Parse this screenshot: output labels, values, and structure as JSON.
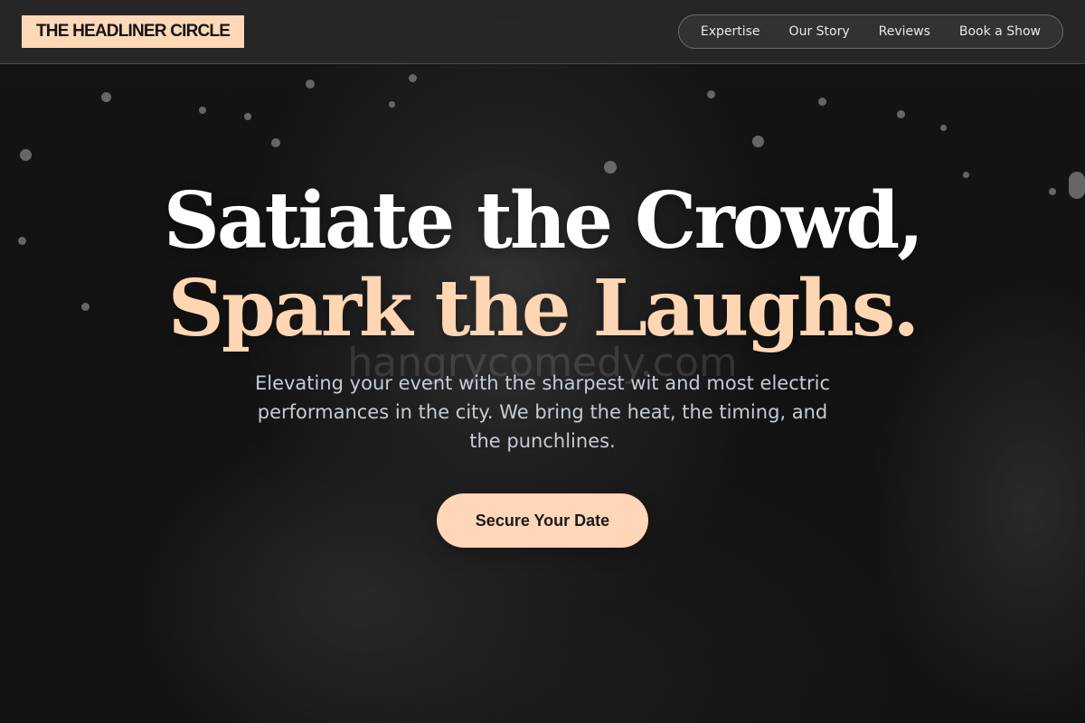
{
  "header": {
    "logo": "THE HEADLINER CIRCLE",
    "nav": [
      "Expertise",
      "Our Story",
      "Reviews",
      "Book a Show"
    ]
  },
  "hero": {
    "headline_line1": "Satiate the Crowd,",
    "headline_line2": "Spark the Laughs.",
    "subtext": "Elevating your event with the sharpest wit and most electric performances in the city. We bring the heat, the timing, and the punchlines.",
    "cta": "Secure Your Date",
    "watermark": "hangrycomedy.com"
  },
  "colors": {
    "accent": "#ffd6b8",
    "header_bg": "#282828",
    "page_bg": "#141414",
    "headline_white": "#ffffff",
    "headline_peach": "#ffd6b3",
    "subtext": "#c5ccd6"
  }
}
